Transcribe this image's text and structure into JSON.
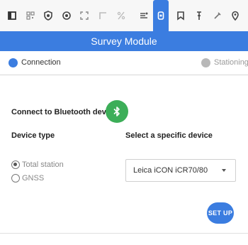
{
  "toolbar": {
    "icons": [
      {
        "name": "window-icon",
        "active": false
      },
      {
        "name": "qr-code-icon",
        "active": false
      },
      {
        "name": "shield-icon",
        "active": false
      },
      {
        "name": "target-icon",
        "active": false
      },
      {
        "name": "expand-icon",
        "active": false
      },
      {
        "name": "corner-icon",
        "active": false
      },
      {
        "name": "percent-icon",
        "active": false
      },
      {
        "name": "list-icon",
        "active": false
      },
      {
        "name": "survey-device-icon",
        "active": true
      },
      {
        "name": "bookmark-icon",
        "active": false
      },
      {
        "name": "pin-icon",
        "active": false
      },
      {
        "name": "tools-icon",
        "active": false
      },
      {
        "name": "location-icon",
        "active": false
      }
    ]
  },
  "header": {
    "title": "Survey Module"
  },
  "stepper": {
    "steps": [
      {
        "label": "Connection",
        "active": true
      },
      {
        "label": "Stationing",
        "active": false
      }
    ]
  },
  "connect": {
    "label": "Connect to Bluetooth device",
    "icon": "bluetooth-icon"
  },
  "device_type": {
    "label": "Device type",
    "options": [
      {
        "label": "Total station",
        "checked": true
      },
      {
        "label": "GNSS",
        "checked": false
      }
    ]
  },
  "specific_device": {
    "label": "Select a specific device",
    "selected": "Leica iCON iCR70/80"
  },
  "actions": {
    "setup_label": "SET UP"
  },
  "colors": {
    "accent": "#3b7de0",
    "bluetooth": "#3cae58"
  }
}
